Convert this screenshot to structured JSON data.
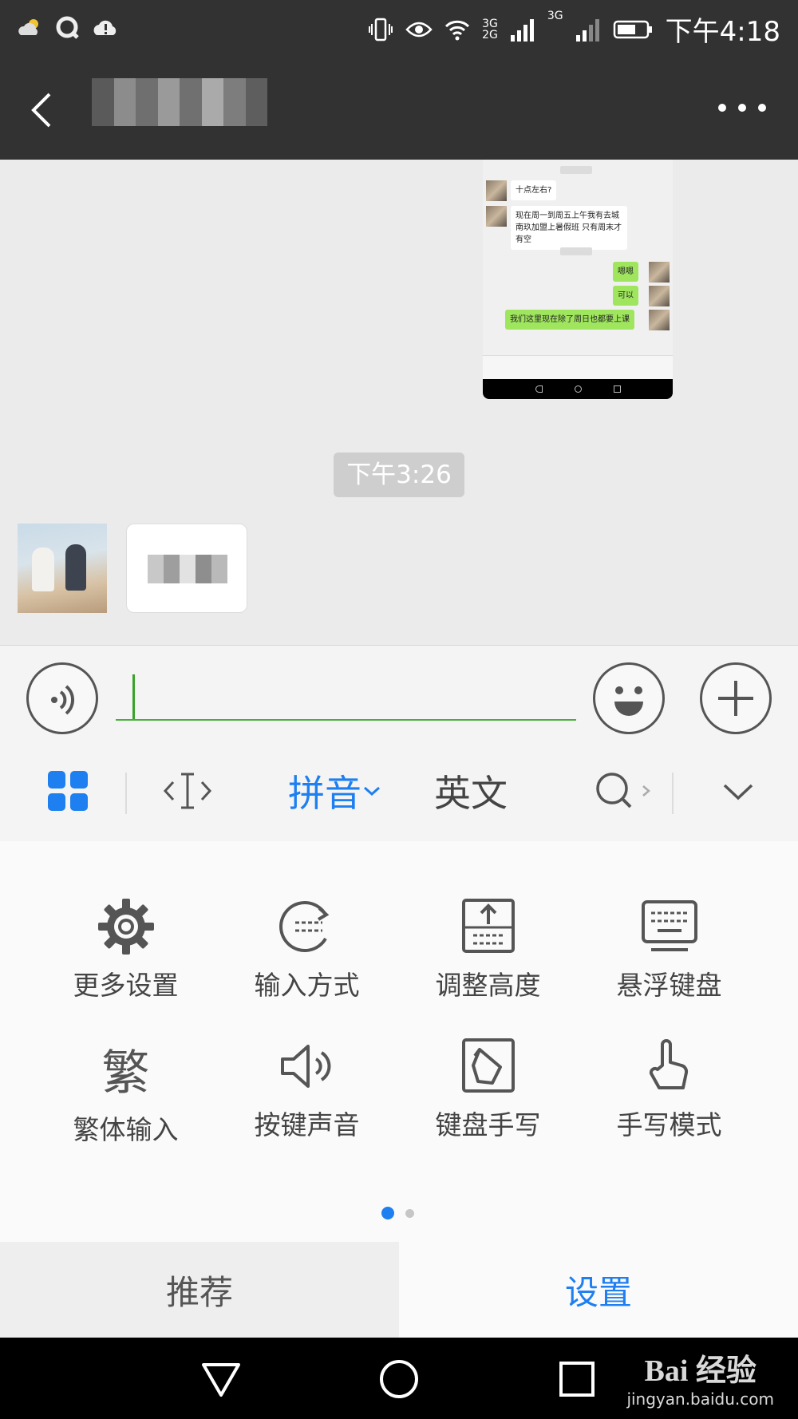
{
  "status_bar": {
    "time": "下午4:18",
    "left_icons": [
      "cloud-sun-icon",
      "q-icon",
      "cloud-alert-icon"
    ],
    "right_icons": [
      "vibrate-icon",
      "eye-icon",
      "wifi-icon",
      "signal-3g-icon",
      "signal-icon",
      "battery-icon"
    ],
    "signal_labels": [
      "3G",
      "2G",
      "3G"
    ]
  },
  "title_bar": {
    "back_icon": "chevron-left-icon",
    "more_icon": "more-dots-icon"
  },
  "chat": {
    "screenshot": {
      "messages_in": [
        "十点左右?",
        "现在周一到周五上午我有去城南玖加盟上暑假班 只有周末才有空"
      ],
      "messages_out": [
        "嗯嗯",
        "可以",
        "我们这里现在除了周日也都要上课"
      ]
    },
    "timestamp": "下午3:26"
  },
  "input_bar": {
    "voice_icon": "voice-icon",
    "emoji_icon": "emoji-icon",
    "plus_icon": "plus-icon",
    "value": ""
  },
  "keyboard_toolbar": {
    "grid_icon": "grid-icon",
    "cursor_icon": "cursor-icon",
    "pinyin": "拼音",
    "english": "英文",
    "search_icon": "search-icon",
    "collapse_icon": "chevron-down-icon"
  },
  "panel": {
    "items": [
      {
        "label": "更多设置",
        "icon": "gear-icon"
      },
      {
        "label": "输入方式",
        "icon": "input-mode-icon"
      },
      {
        "label": "调整高度",
        "icon": "adjust-height-icon"
      },
      {
        "label": "悬浮键盘",
        "icon": "floating-keyboard-icon"
      },
      {
        "label": "繁体输入",
        "icon": "traditional-icon",
        "glyph": "繁"
      },
      {
        "label": "按键声音",
        "icon": "speaker-icon"
      },
      {
        "label": "键盘手写",
        "icon": "handwriting-icon"
      },
      {
        "label": "手写模式",
        "icon": "hand-icon"
      }
    ],
    "page_current": 1,
    "page_total": 2
  },
  "bottom_tabs": {
    "recommend": "推荐",
    "settings": "设置"
  },
  "nav_bar": {
    "watermark_main": "Bai 经验",
    "watermark_sub": "jingyan.baidu.com"
  },
  "colors": {
    "accent": "#1e7ff0",
    "header": "#323232",
    "input_underline": "#4aaf3a",
    "bubble_out": "#9fe65e"
  }
}
